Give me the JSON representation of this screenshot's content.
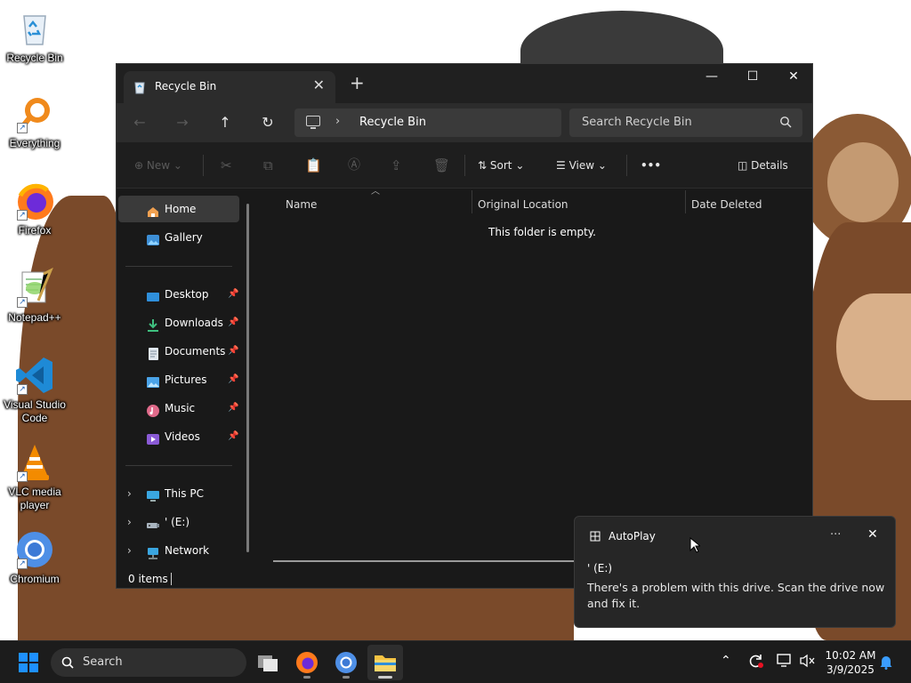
{
  "desktop": {
    "icons": [
      {
        "label": "Recycle Bin",
        "icon": "recycle-bin-icon"
      },
      {
        "label": "Everything",
        "icon": "everything-search-icon"
      },
      {
        "label": "Firefox",
        "icon": "firefox-icon"
      },
      {
        "label": "Notepad++",
        "icon": "notepad-plus-plus-icon"
      },
      {
        "label": "Visual Studio Code",
        "icon": "vscode-icon"
      },
      {
        "label": "VLC media player",
        "icon": "vlc-icon"
      },
      {
        "label": "Chromium",
        "icon": "chromium-icon"
      }
    ]
  },
  "explorer": {
    "tab_title": "Recycle Bin",
    "tab_close": "✕",
    "new_tab": "+",
    "window_buttons": {
      "minimize": "—",
      "maximize": "☐",
      "close": "✕"
    },
    "nav": {
      "back": "←",
      "forward": "→",
      "up": "↑",
      "refresh": "↻"
    },
    "breadcrumb": [
      "Recycle Bin"
    ],
    "search_placeholder": "Search Recycle Bin",
    "toolbar": {
      "new_label": "New",
      "sort_label": "Sort",
      "view_label": "View",
      "more_label": "•••",
      "details_label": "Details"
    },
    "sidebar": {
      "quick": [
        {
          "label": "Home",
          "icon": "home-icon",
          "selected": true
        },
        {
          "label": "Gallery",
          "icon": "gallery-icon"
        }
      ],
      "pinned": [
        {
          "label": "Desktop",
          "icon": "desktop-folder-icon"
        },
        {
          "label": "Downloads",
          "icon": "downloads-folder-icon"
        },
        {
          "label": "Documents",
          "icon": "documents-folder-icon"
        },
        {
          "label": "Pictures",
          "icon": "pictures-folder-icon"
        },
        {
          "label": "Music",
          "icon": "music-folder-icon"
        },
        {
          "label": "Videos",
          "icon": "videos-folder-icon"
        }
      ],
      "locations": [
        {
          "label": "This PC",
          "icon": "this-pc-icon"
        },
        {
          "label": "' (E:)",
          "icon": "usb-drive-icon"
        },
        {
          "label": "Network",
          "icon": "network-icon"
        }
      ]
    },
    "columns": [
      "Name",
      "Original Location",
      "Date Deleted"
    ],
    "empty_message": "This folder is empty.",
    "status": {
      "items_count": "0 items"
    }
  },
  "toast": {
    "app_name": "AutoPlay",
    "more": "···",
    "close": "✕",
    "title": "' (E:)",
    "body": "There's a problem with this drive.  Scan the drive now and fix it."
  },
  "taskbar": {
    "search_label": "Search",
    "apps": [
      "start-icon",
      "task-view-icon",
      "firefox-icon",
      "chromium-icon",
      "file-explorer-icon"
    ],
    "clock_time": "10:02 AM",
    "clock_date": "3/9/2025"
  },
  "colors": {
    "window_bg": "#191919",
    "titlebar_bg": "#202020",
    "accent": "#0078d4",
    "taskbar_bg": "#1c1c1c"
  }
}
